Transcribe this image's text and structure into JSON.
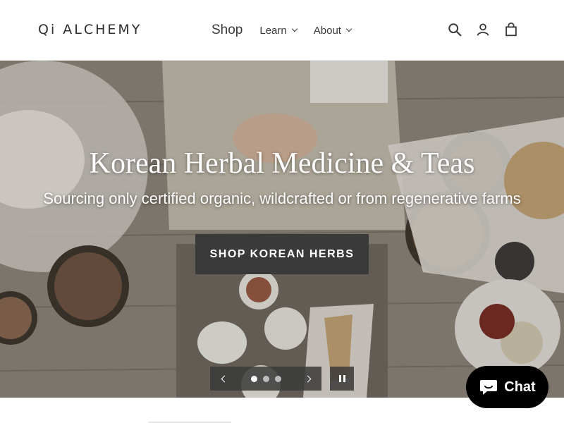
{
  "header": {
    "logo": "Qi ALCHEMY",
    "nav": [
      {
        "label": "Shop",
        "dropdown": false
      },
      {
        "label": "Learn",
        "dropdown": true
      },
      {
        "label": "About",
        "dropdown": true
      }
    ],
    "icons": [
      "search-icon",
      "account-icon",
      "cart-icon"
    ]
  },
  "hero": {
    "title": "Korean Herbal Medicine & Teas",
    "subtitle": "Sourcing only certified organic, wildcrafted or from regenerative farms",
    "button_label": "SHOP KOREAN HERBS",
    "slides": {
      "count": 3,
      "active": 1
    }
  },
  "chat": {
    "label": "Chat"
  },
  "colors": {
    "button_bg": "#3a3a3a",
    "chat_bg": "#000000",
    "text": "#3a3a3a"
  }
}
